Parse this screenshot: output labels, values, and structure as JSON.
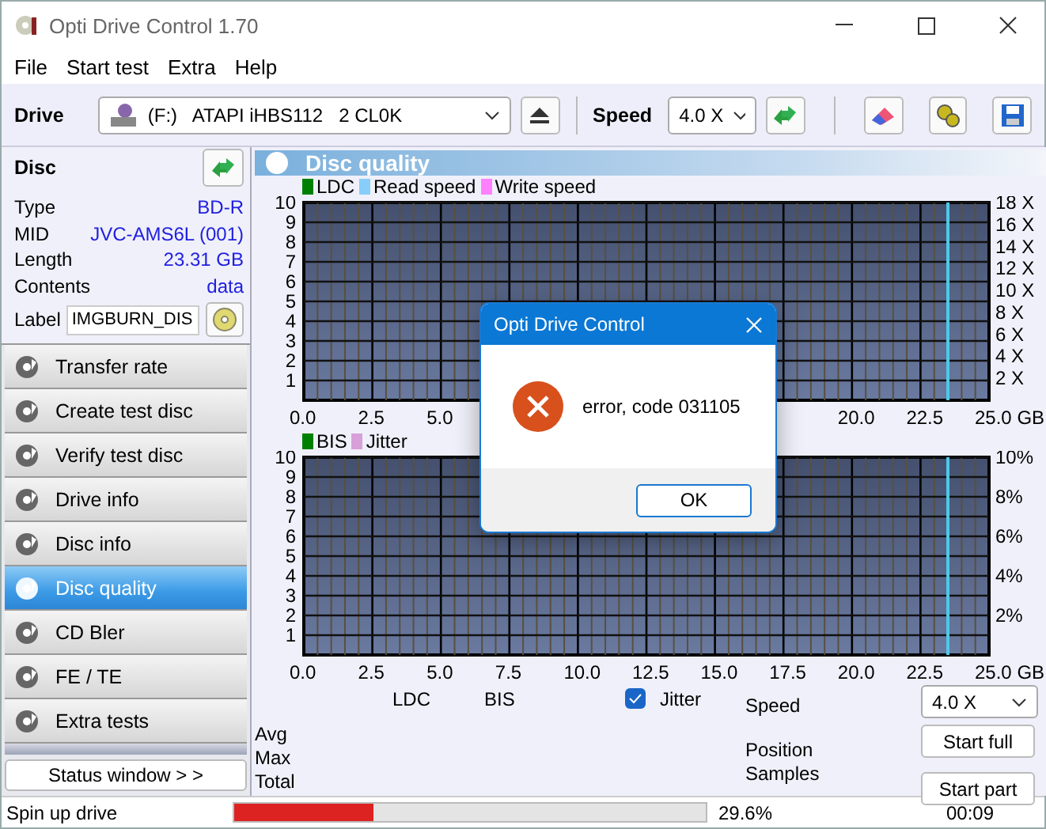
{
  "window": {
    "title": "Opti Drive Control 1.70"
  },
  "menu": [
    "File",
    "Start test",
    "Extra",
    "Help"
  ],
  "toolbar": {
    "drive_label": "Drive",
    "drive": "(F:)   ATAPI iHBS112   2 CL0K",
    "speed_label": "Speed",
    "speed": "4.0 X"
  },
  "disc": {
    "title": "Disc",
    "fields": [
      {
        "label": "Type",
        "value": "BD-R"
      },
      {
        "label": "MID",
        "value": "JVC-AMS6L (001)"
      },
      {
        "label": "Length",
        "value": "23.31 GB"
      },
      {
        "label": "Contents",
        "value": "data"
      }
    ],
    "label_caption": "Label",
    "label_value": "IMGBURN_DIS"
  },
  "nav": [
    {
      "label": "Transfer rate",
      "selected": false
    },
    {
      "label": "Create test disc",
      "selected": false
    },
    {
      "label": "Verify test disc",
      "selected": false
    },
    {
      "label": "Drive info",
      "selected": false
    },
    {
      "label": "Disc info",
      "selected": false
    },
    {
      "label": "Disc quality",
      "selected": true
    },
    {
      "label": "CD Bler",
      "selected": false
    },
    {
      "label": "FE / TE",
      "selected": false
    },
    {
      "label": "Extra tests",
      "selected": false
    }
  ],
  "status_window_button": "Status window > >",
  "panel": {
    "title": "Disc quality",
    "charts": [
      {
        "chart_data": {
          "type": "line",
          "ylim": [
            0,
            10
          ],
          "grid": true,
          "categories": [
            "0.0",
            "2.5",
            "5.0",
            null,
            null,
            null,
            null,
            null,
            "20.0",
            "22.5",
            "25.0 GB"
          ],
          "yticks": [
            1,
            2,
            3,
            4,
            5,
            6,
            7,
            8,
            9,
            10
          ],
          "series": [
            {
              "name": "LDC",
              "color": "#008000",
              "values": [
                null,
                null,
                null,
                null,
                null,
                null,
                null,
                null,
                null,
                null,
                null
              ]
            },
            {
              "name": "Read speed",
              "color": "#87cefa",
              "values": [
                null,
                null,
                null,
                null,
                null,
                null,
                null,
                null,
                null,
                null,
                null
              ]
            },
            {
              "name": "Write speed",
              "color": "#ff80ff",
              "values": [
                null,
                null,
                null,
                null,
                null,
                null,
                null,
                null,
                null,
                null,
                null
              ]
            }
          ],
          "y2lim": [
            0,
            18
          ],
          "y2ticks": [
            {
              "value": 2,
              "label": "2 X"
            },
            {
              "value": 4,
              "label": "4 X"
            },
            {
              "value": 6,
              "label": "6 X"
            },
            {
              "value": 8,
              "label": "8 X"
            },
            {
              "value": 10,
              "label": "10 X"
            },
            {
              "value": 12,
              "label": "12 X"
            },
            {
              "value": 14,
              "label": "14 X"
            },
            {
              "value": 16,
              "label": "16 X"
            },
            {
              "value": 18,
              "label": "18 X"
            }
          ]
        }
      },
      {
        "chart_data": {
          "type": "line",
          "ylim": [
            0,
            10
          ],
          "grid": true,
          "categories": [
            "0.0",
            "2.5",
            "5.0",
            "7.5",
            "10.0",
            "12.5",
            "15.0",
            "17.5",
            "20.0",
            "22.5",
            "25.0 GB"
          ],
          "yticks": [
            1,
            2,
            3,
            4,
            5,
            6,
            7,
            8,
            9,
            10
          ],
          "series": [
            {
              "name": "BIS",
              "color": "#008000",
              "values": [
                null,
                null,
                null,
                null,
                null,
                null,
                null,
                null,
                null,
                null,
                null
              ]
            },
            {
              "name": "Jitter",
              "color": "#d8a0d8",
              "values": [
                null,
                null,
                null,
                null,
                null,
                null,
                null,
                null,
                null,
                null,
                null
              ]
            }
          ],
          "y2lim": [
            0,
            10
          ],
          "y2ticks": [
            {
              "value": 2,
              "label": "2%"
            },
            {
              "value": 4,
              "label": "4%"
            },
            {
              "value": 6,
              "label": "6%"
            },
            {
              "value": 8,
              "label": "8%"
            },
            {
              "value": 10,
              "label": "10%"
            }
          ]
        }
      }
    ]
  },
  "stats": {
    "columns": [
      "LDC",
      "BIS"
    ],
    "jitter": {
      "label": "Jitter",
      "checked": true
    },
    "rows": [
      "Avg",
      "Max",
      "Total"
    ],
    "speed_label": "Speed",
    "speed": "4.0 X",
    "info": [
      "Position",
      "Samples"
    ],
    "buttons": [
      "Start full",
      "Start part"
    ]
  },
  "status_bar": {
    "message": "Spin up drive",
    "level": 0.296,
    "percent": "29.6%",
    "time": "00:09"
  },
  "dialog": {
    "title": "Opti Drive Control",
    "message": "error, code 031105",
    "button": "OK"
  }
}
